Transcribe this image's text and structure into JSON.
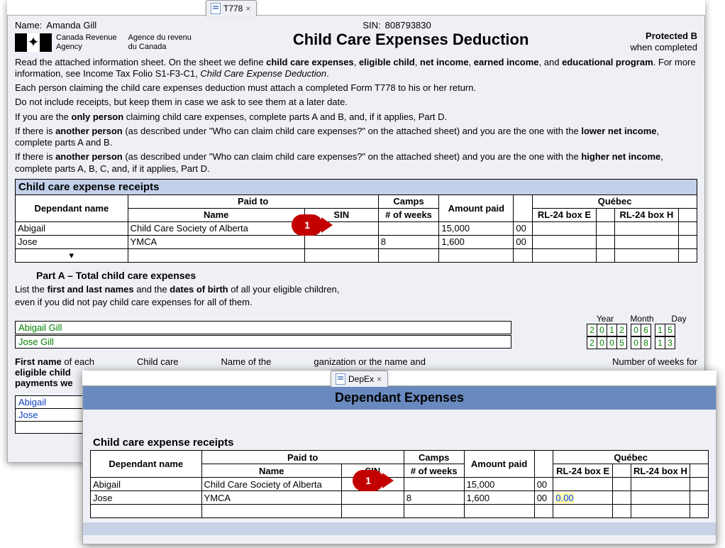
{
  "tabs": {
    "t778": "T778",
    "depex": "DepEx"
  },
  "header": {
    "name_label": "Name:",
    "name": "Amanda Gill",
    "sin_label": "SIN:",
    "sin": "808793830",
    "agency_en1": "Canada Revenue",
    "agency_en2": "Agency",
    "agency_fr1": "Agence du revenu",
    "agency_fr2": "du Canada",
    "title": "Child Care Expenses Deduction",
    "protected": "Protected B",
    "when": "when completed"
  },
  "instructions": {
    "p1a": "Read the attached information sheet. On the sheet we define ",
    "p1b": "child care expenses",
    "p1c": ", ",
    "p1d": "eligible child",
    "p1e": ", ",
    "p1f": "net income",
    "p1g": ", ",
    "p1h": "earned income",
    "p1i": ", and ",
    "p1j": "educational program",
    "p1k": ". For more information, see Income Tax Folio S1-F3-C1, ",
    "p1l": "Child Care Expense Deduction",
    "p1m": ".",
    "p2": "Each person claiming the child care expenses deduction must attach a completed Form T778 to his or her return.",
    "p3": "Do not include receipts, but keep them in case we ask to see them at a later date.",
    "p4a": "If you are the ",
    "p4b": "only person",
    "p4c": " claiming child care expenses, complete parts A and B, and, if it applies, Part D.",
    "p5a": "If there is ",
    "p5b": "another person",
    "p5c": " (as described under \"Who can claim child care expenses?\" on the attached sheet) and you are the one with the ",
    "p5d": "lower net income",
    "p5e": ", complete parts A and B.",
    "p6a": "If there is ",
    "p6b": "another person",
    "p6c": " (as described under \"Who can claim child care expenses?\" on the attached sheet) and you are the one with the ",
    "p6d": "higher net income",
    "p6e": ", complete parts A, B, C, and, if it applies, Part D."
  },
  "receipts_section": "Child care expense receipts",
  "table": {
    "col_dependant": "Dependant name",
    "col_paidto": "Paid to",
    "col_name": "Name",
    "col_sin": "SIN",
    "col_camps": "Camps",
    "col_weeks": "# of weeks",
    "col_amount": "Amount paid",
    "col_quebec": "Québec",
    "col_rl24e": "RL-24 box E",
    "col_rl24h": "RL-24 box H",
    "rows": [
      {
        "dependant": "Abigail",
        "payee": "Child Care Society of Alberta",
        "sin": "",
        "weeks": "",
        "amount": "15,000",
        "cents": "00",
        "rle": "",
        "rlh": ""
      },
      {
        "dependant": "Jose",
        "payee": "YMCA",
        "sin": "",
        "weeks": "8",
        "amount": "1,600",
        "cents": "00",
        "rle": "",
        "rlh": ""
      }
    ]
  },
  "partA": {
    "head": "Part A – Total child care expenses",
    "list1a": "List the ",
    "list1b": "first and last names",
    "list1c": " and the ",
    "list1d": "dates of birth",
    "list1e": " of all your eligible children,",
    "list2": "even if you did not pay child care expenses for all of them.",
    "year": "Year",
    "month": "Month",
    "day": "Day",
    "children": [
      {
        "name": "Abigail Gill",
        "dob": [
          "2",
          "0",
          "1",
          "2",
          "0",
          "6",
          "1",
          "5"
        ]
      },
      {
        "name": "Jose Gill",
        "dob": [
          "2",
          "0",
          "0",
          "5",
          "0",
          "8",
          "1",
          "3"
        ]
      }
    ],
    "bottom1a": "First name",
    "bottom1b": " of each",
    "bottom2": "eligible child",
    "bottom3": "payments we",
    "bottom_cc": "Child care",
    "bottom_org": "Name of the",
    "bottom_org2": "ganization",
    "bottom_org3": " or the name and",
    "bottom_weeks": "Number of weeks for",
    "r_abigail": "Abigail",
    "r_jose": "Jose"
  },
  "win2": {
    "title": "Dependant Expenses",
    "rl_e_highlight": "0.00"
  },
  "pins": {
    "one": "1"
  }
}
